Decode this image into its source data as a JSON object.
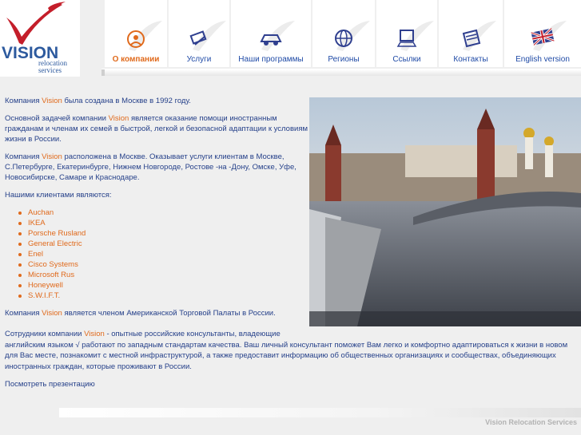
{
  "logo": {
    "brand": "VISION",
    "sub_line1": "relocation",
    "sub_line2": "services"
  },
  "nav": [
    {
      "label": "О компании",
      "icon": "globe-person-icon",
      "active": true
    },
    {
      "label": "Услуги",
      "icon": "tools-icon",
      "active": false
    },
    {
      "label": "Наши программы",
      "icon": "car-icon",
      "active": false
    },
    {
      "label": "Регионы",
      "icon": "globe-icon",
      "active": false
    },
    {
      "label": "Ссылки",
      "icon": "computer-icon",
      "active": false
    },
    {
      "label": "Контакты",
      "icon": "book-icon",
      "active": false
    },
    {
      "label": "English version",
      "icon": "uk-flag-icon",
      "active": false
    }
  ],
  "content": {
    "p1_a": "Компания ",
    "p1_b": "Vision",
    "p1_c": " была создана в Москве в 1992 году.",
    "p2_a": "Основной задачей компании ",
    "p2_b": "Vision",
    "p2_c": " является оказание помощи иностранным гражданам и членам их семей в быстрой, легкой и безопасной адаптации к условиям жизни в России.",
    "p3_a": "Компания ",
    "p3_b": "Vision",
    "p3_c": " расположена в Москве. Оказывает услуги клиентам в Москве, С.Петербурге, Екатеринбурге,  Нижнем Новгороде, Ростове -на -Дону, Омске, Уфе, Новосибирске, Самаре и Краснодаре.",
    "clients_title": "Нашими клиентами являются:",
    "clients": [
      "Auchan",
      "IKEA",
      "Porsche Rusland",
      "General Electric",
      "Enel",
      "Cisco Systems",
      "Microsoft Rus",
      "Honeywell",
      "S.W.I.F.T."
    ],
    "p4_a": "Компания ",
    "p4_b": "Vision",
    "p4_c": " является членом Американской Торговой Палаты в России.",
    "p5_a": "Сотрудники компании ",
    "p5_b": "Vision",
    "p5_c": " - опытные российские консультанты, владеющие",
    "p5_d": "английским языком √ работают по западным стандартам качества. Ваш личный консультант поможет Вам легко и комфортно адаптироваться к жизни в новом для Вас месте, познакомит с местной инфраструктурой, а также предоставит информацию об общественных организациях и сообществах, объединяющих иностранных граждан, которые проживают в России.",
    "presentation_link": "Посмотреть презентацию"
  },
  "footer": "Vision Relocation Services",
  "colors": {
    "accent": "#e06a1c",
    "text": "#26418a",
    "brand": "#2d5a9e",
    "logo_red": "#c41e2a"
  }
}
